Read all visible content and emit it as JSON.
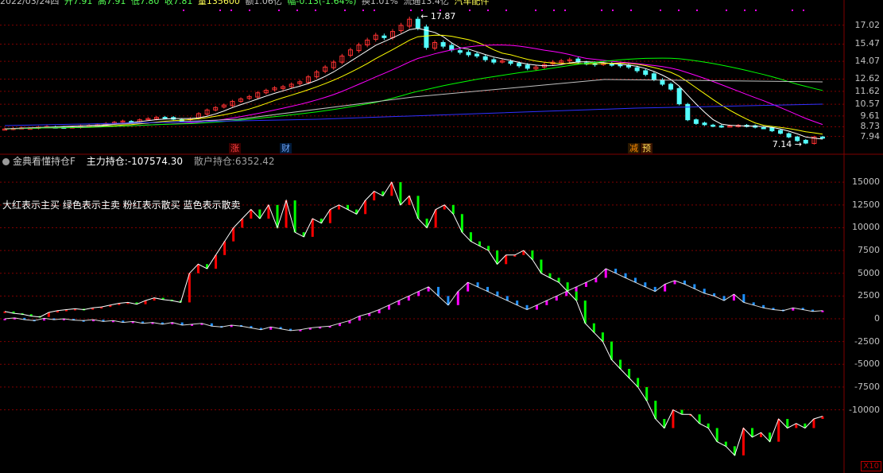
{
  "info_bar": {
    "date": "2022/03/24四",
    "open": "开7.91",
    "high": "高7.91",
    "low": "低7.80",
    "close": "收7.81",
    "volume": "量135600",
    "amount": "额1.06亿",
    "change": "幅-0.13(-1.64%)",
    "turnover": "换1.01%",
    "float": "流通13.4亿",
    "sector": "汽车配件"
  },
  "price_axis": [
    "17.02",
    "15.47",
    "14.07",
    "12.62",
    "11.62",
    "10.57",
    "9.61",
    "8.73",
    "7.94"
  ],
  "price_annotations": {
    "high": "17.87",
    "low": "7.14"
  },
  "badges": {
    "zhang": "涨",
    "cai": "财",
    "jianchi": "减",
    "yu": "预"
  },
  "indicator": {
    "name": "金典看懂持仓F",
    "main_label": "主力持仓:",
    "main_value": "-107574.30",
    "retail_label": "散户持仓:",
    "retail_value": "6352.42",
    "note": "大红表示主买 绿色表示主卖 粉红表示散买 蓝色表示散卖",
    "scale": "X10"
  },
  "indicator_axis": [
    "15000",
    "12500",
    "10000",
    "7500",
    "5000",
    "2500",
    "0",
    "-2500",
    "-5000",
    "-7500",
    "-10000"
  ],
  "colors": {
    "bg": "#000000",
    "grid": "#800000",
    "up": "#ff3232",
    "down": "#54ffff",
    "main_buy": "#ff0000",
    "main_sell": "#00ff00",
    "retail_buy": "#ff00ff",
    "retail_sell": "#1e90ff",
    "ma5": "#ffffff",
    "ma10": "#ffff00",
    "ma20": "#ff00ff",
    "ma60": "#00ff00",
    "ma120": "#c0c0c0",
    "ma250": "#3030ff"
  },
  "chart_data": {
    "type": "line",
    "price_series": [
      8.55,
      8.6,
      8.65,
      8.62,
      8.7,
      8.75,
      8.7,
      8.68,
      8.72,
      8.8,
      8.85,
      8.9,
      9.0,
      9.1,
      9.2,
      9.15,
      9.3,
      9.4,
      9.5,
      9.45,
      9.35,
      9.3,
      9.4,
      9.8,
      10.1,
      10.3,
      10.5,
      10.8,
      11.0,
      11.2,
      11.5,
      11.7,
      11.9,
      12.0,
      12.2,
      12.4,
      12.8,
      13.2,
      13.6,
      14.0,
      14.5,
      15.0,
      15.4,
      15.8,
      16.2,
      16.0,
      16.5,
      17.0,
      17.5,
      16.8,
      15.2,
      15.6,
      15.3,
      15.0,
      14.8,
      14.6,
      14.5,
      14.2,
      14.0,
      14.1,
      13.9,
      13.7,
      13.5,
      13.6,
      13.8,
      14.0,
      14.1,
      14.2,
      14.0,
      13.9,
      13.8,
      13.9,
      13.8,
      13.7,
      13.6,
      13.3,
      13.0,
      12.6,
      12.2,
      11.8,
      10.6,
      9.3,
      9.0,
      8.9,
      8.8,
      8.75,
      8.8,
      8.85,
      8.78,
      8.7,
      8.65,
      8.4,
      8.2,
      7.9,
      7.6,
      7.4,
      7.9,
      7.81
    ],
    "main_series": [
      800,
      600,
      500,
      300,
      200,
      700,
      900,
      1000,
      1100,
      1000,
      1200,
      1300,
      1500,
      1700,
      1800,
      1600,
      2000,
      2300,
      2100,
      2000,
      1800,
      5000,
      6000,
      5500,
      7000,
      8500,
      10000,
      11000,
      12000,
      11000,
      12500,
      10000,
      13000,
      9500,
      9000,
      11000,
      10500,
      12000,
      12500,
      12000,
      11500,
      13000,
      14000,
      13500,
      15000,
      12500,
      13500,
      11000,
      10000,
      12000,
      12500,
      11500,
      9500,
      8500,
      8000,
      7500,
      6000,
      7000,
      7000,
      7500,
      6500,
      5000,
      4500,
      4000,
      3000,
      2000,
      -500,
      -1500,
      -2500,
      -4500,
      -5500,
      -6500,
      -7500,
      -9000,
      -11000,
      -12000,
      -10000,
      -10500,
      -10500,
      -11500,
      -12000,
      -13500,
      -14000,
      -15000,
      -12000,
      -13000,
      -12500,
      -13500,
      -11000,
      -12000,
      -11500,
      -12000,
      -11000,
      -10700
    ],
    "retail_series": [
      0,
      100,
      -100,
      -200,
      50,
      -100,
      0,
      -150,
      -200,
      -100,
      -300,
      -200,
      -400,
      -300,
      -500,
      -400,
      -600,
      -400,
      -700,
      -600,
      -500,
      -800,
      -900,
      -700,
      -800,
      -1000,
      -1200,
      -900,
      -1100,
      -1300,
      -1200,
      -1000,
      -900,
      -800,
      -500,
      -200,
      300,
      600,
      1000,
      1500,
      2000,
      2500,
      3000,
      3500,
      2500,
      1500,
      3000,
      4000,
      3500,
      3000,
      2500,
      2000,
      1500,
      1000,
      1500,
      2000,
      2500,
      3000,
      3500,
      4000,
      4500,
      5500,
      5000,
      4500,
      4000,
      3500,
      3000,
      3800,
      4200,
      3800,
      3300,
      2800,
      2500,
      2000,
      2700,
      1800,
      1500,
      1200,
      1000,
      900,
      1200,
      1000,
      800,
      900
    ]
  }
}
